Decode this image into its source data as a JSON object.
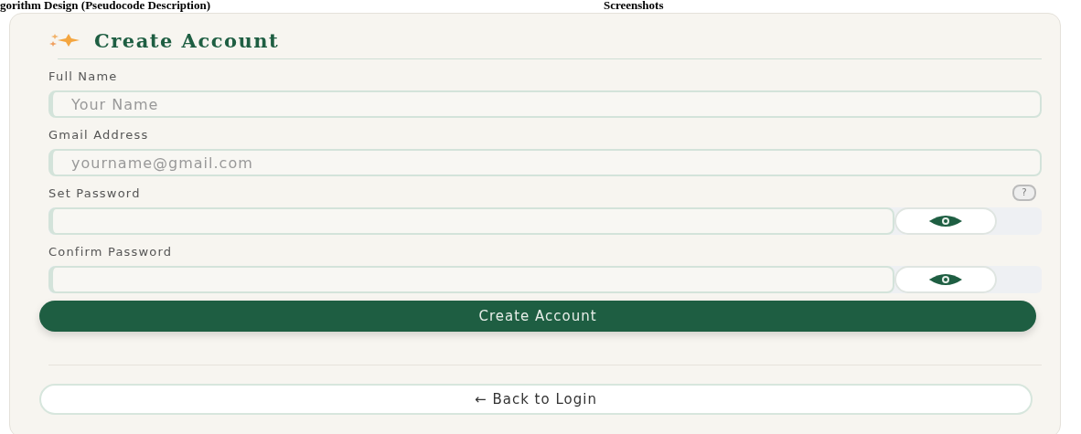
{
  "document": {
    "heading": "gorithm Design (Pseudocode Description)",
    "section": "Screenshots"
  },
  "form": {
    "title": "Create Account",
    "fields": [
      {
        "label": "Full Name",
        "placeholder": "Your Name",
        "kind": "text"
      },
      {
        "label": "Gmail Address",
        "placeholder": "yourname@gmail.com",
        "kind": "text"
      },
      {
        "label": "Set Password",
        "kind": "password",
        "help": "?"
      },
      {
        "label": "Confirm Password",
        "kind": "password"
      }
    ],
    "submit": "Create Account",
    "back_link": "← Back to Login"
  }
}
